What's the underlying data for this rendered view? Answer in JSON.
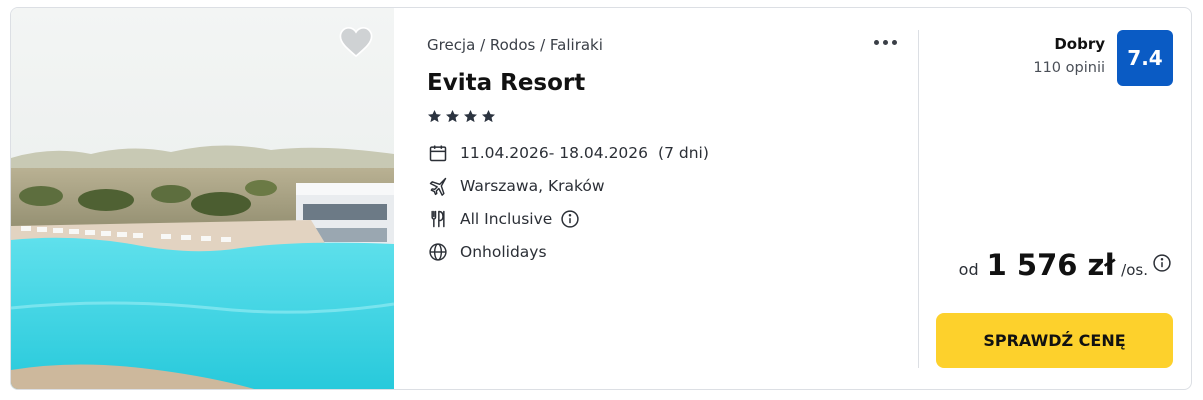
{
  "offer": {
    "breadcrumb": "Grecja / Rodos / Faliraki",
    "title": "Evita Resort",
    "stars": 4,
    "dates": "11.04.2026- 18.04.2026",
    "duration": "(7 dni)",
    "departure": "Warszawa, Kraków",
    "board": "All Inclusive",
    "operator": "Onholidays"
  },
  "rating": {
    "label": "Dobry",
    "count": "110 opinii",
    "score": "7.4"
  },
  "price": {
    "prefix": "od",
    "amount": "1 576 zł",
    "suffix": "/os."
  },
  "cta": {
    "label": "SPRAWDŹ CENĘ"
  },
  "colors": {
    "rating_badge": "#0a5bc4",
    "cta_button": "#fdd12c",
    "pool_water": "#3fd6e6"
  },
  "icons": {
    "favorite": "heart-icon",
    "menu": "more-dots-icon",
    "dates": "calendar-icon",
    "departure": "plane-icon",
    "board": "cutlery-icon",
    "operator": "globe-icon",
    "info": "info-circle-icon"
  }
}
